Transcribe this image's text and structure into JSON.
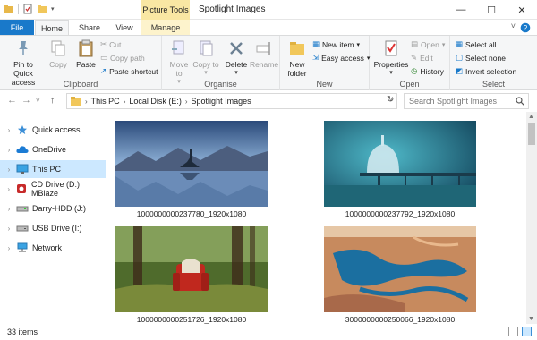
{
  "window": {
    "title": "Spotlight Images",
    "context_tab_group": "Picture Tools",
    "controls": [
      "—",
      "☐",
      "✕"
    ]
  },
  "ribbon_tabs": {
    "file": "File",
    "home": "Home",
    "share": "Share",
    "view": "View",
    "manage": "Manage"
  },
  "clipboard": {
    "label": "Clipboard",
    "pin": "Pin to Quick access",
    "copy": "Copy",
    "paste": "Paste",
    "cut": "Cut",
    "copy_path": "Copy path",
    "paste_shortcut": "Paste shortcut"
  },
  "organise": {
    "label": "Organise",
    "move_to": "Move to",
    "copy_to": "Copy to",
    "delete": "Delete",
    "rename": "Rename"
  },
  "new": {
    "label": "New",
    "new_folder": "New folder",
    "new_item": "New item",
    "easy_access": "Easy access"
  },
  "open": {
    "label": "Open",
    "properties": "Properties",
    "open": "Open",
    "edit": "Edit",
    "history": "History"
  },
  "select": {
    "label": "Select",
    "select_all": "Select all",
    "select_none": "Select none",
    "invert": "Invert selection"
  },
  "address": {
    "crumbs": [
      "This PC",
      "Local Disk (E:)",
      "Spotlight Images"
    ],
    "search_placeholder": "Search Spotlight Images"
  },
  "nav": [
    {
      "label": "Quick access",
      "icon": "star-icon"
    },
    {
      "label": "OneDrive",
      "icon": "cloud-icon"
    },
    {
      "label": "This PC",
      "icon": "computer-icon",
      "selected": true
    },
    {
      "label": "CD Drive (D:) MBlaze",
      "icon": "cd-drive-icon"
    },
    {
      "label": "Darry-HDD (J:)",
      "icon": "drive-icon"
    },
    {
      "label": "USB Drive (I:)",
      "icon": "usb-drive-icon"
    },
    {
      "label": "Network",
      "icon": "network-icon"
    }
  ],
  "files": [
    {
      "name": "1000000000237780_1920x1080"
    },
    {
      "name": "1000000000237792_1920x1080"
    },
    {
      "name": "1000000000251726_1920x1080"
    },
    {
      "name": "3000000000250066_1920x1080"
    }
  ],
  "status": {
    "item_count": "33 items"
  },
  "colors": {
    "accent": "#1979ca",
    "selection": "#cce8ff",
    "context_tab": "#f9e7a3"
  }
}
